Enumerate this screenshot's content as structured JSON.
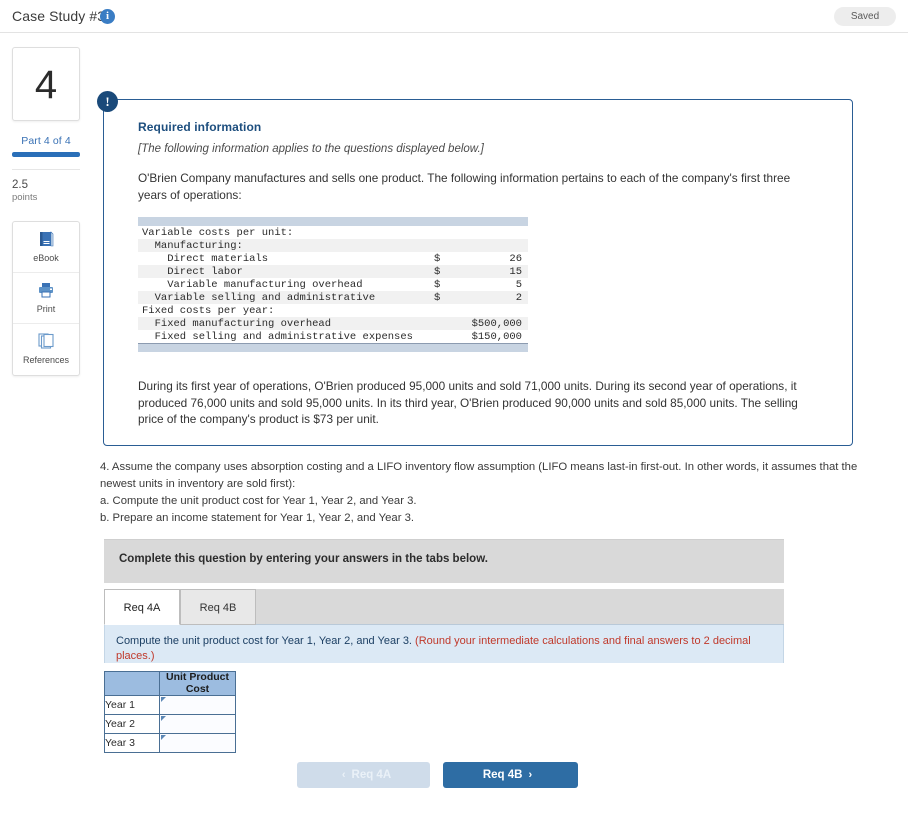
{
  "topbar": {
    "title": "Case Study #3",
    "info_icon": "info-icon",
    "saved_label": "Saved"
  },
  "sidebar": {
    "part_number": "4",
    "part_label": "Part 4 of 4",
    "progress_percent": 100,
    "points_value": "2.5",
    "points_word": "points",
    "tools": [
      {
        "label": "eBook",
        "icon": "ebook-icon"
      },
      {
        "label": "Print",
        "icon": "printer-icon"
      },
      {
        "label": "References",
        "icon": "references-icon"
      }
    ]
  },
  "required_info": {
    "badge": "!",
    "title": "Required information",
    "italic_note": "[The following information applies to the questions displayed below.]",
    "paragraph": "O'Brien Company manufactures and sells one product. The following information pertains to each of the company's first three years of operations:",
    "paragraph2": "During its first year of operations, O'Brien produced 95,000 units and sold 71,000 units. During its second year of operations, it produced 76,000 units and sold 95,000 units. In its third year, O'Brien produced 90,000 units and sold 85,000 units. The selling price of the company's product is $73 per unit.",
    "cost_table": [
      {
        "name": "Variable costs per unit:",
        "symbol": "",
        "amount": "",
        "alt": false
      },
      {
        "name": "  Manufacturing:",
        "symbol": "",
        "amount": "",
        "alt": true
      },
      {
        "name": "    Direct materials",
        "symbol": "$",
        "amount": "26",
        "alt": false
      },
      {
        "name": "    Direct labor",
        "symbol": "$",
        "amount": "15",
        "alt": true
      },
      {
        "name": "    Variable manufacturing overhead",
        "symbol": "$",
        "amount": "5",
        "alt": false
      },
      {
        "name": "  Variable selling and administrative",
        "symbol": "$",
        "amount": "2",
        "alt": true
      },
      {
        "name": "Fixed costs per year:",
        "symbol": "",
        "amount": "",
        "alt": false
      },
      {
        "name": "  Fixed manufacturing overhead",
        "symbol": "",
        "amount": "$500,000",
        "alt": true
      },
      {
        "name": "  Fixed selling and administrative expenses",
        "symbol": "",
        "amount": "$150,000",
        "alt": false
      }
    ]
  },
  "question": {
    "line1": "4. Assume the company uses absorption costing and a LIFO inventory flow assumption (LIFO means last-in first-out. In other words, it assumes that the newest units in inventory are sold first):",
    "line2": "a. Compute the unit product cost for Year 1, Year 2, and Year 3.",
    "line3": "b. Prepare an income statement for Year 1, Year 2, and Year 3."
  },
  "complete_question": {
    "instruction": "Complete this question by entering your answers in the tabs below.",
    "tabs": [
      {
        "label": "Req 4A",
        "active": true
      },
      {
        "label": "Req 4B",
        "active": false
      }
    ],
    "panel_text": "Compute the unit product cost for Year 1, Year 2, and Year 3. ",
    "panel_text_highlight": "(Round your intermediate calculations and final answers to 2 decimal places.)"
  },
  "answer_table": {
    "header_blank": "",
    "header_col": "Unit Product Cost",
    "rows": [
      {
        "label": "Year 1",
        "value": ""
      },
      {
        "label": "Year 2",
        "value": ""
      },
      {
        "label": "Year 3",
        "value": ""
      }
    ]
  },
  "nav": {
    "prev_label": "Req 4A",
    "prev_chevron": "‹",
    "next_label": "Req 4B",
    "next_chevron": "›"
  },
  "colors": {
    "accent_blue": "#2e6da4",
    "badge_navy": "#1a4a7a",
    "panel_blue": "#dce9f5",
    "table_header_blue": "#9cbce0",
    "highlight_red": "#c0392b"
  }
}
